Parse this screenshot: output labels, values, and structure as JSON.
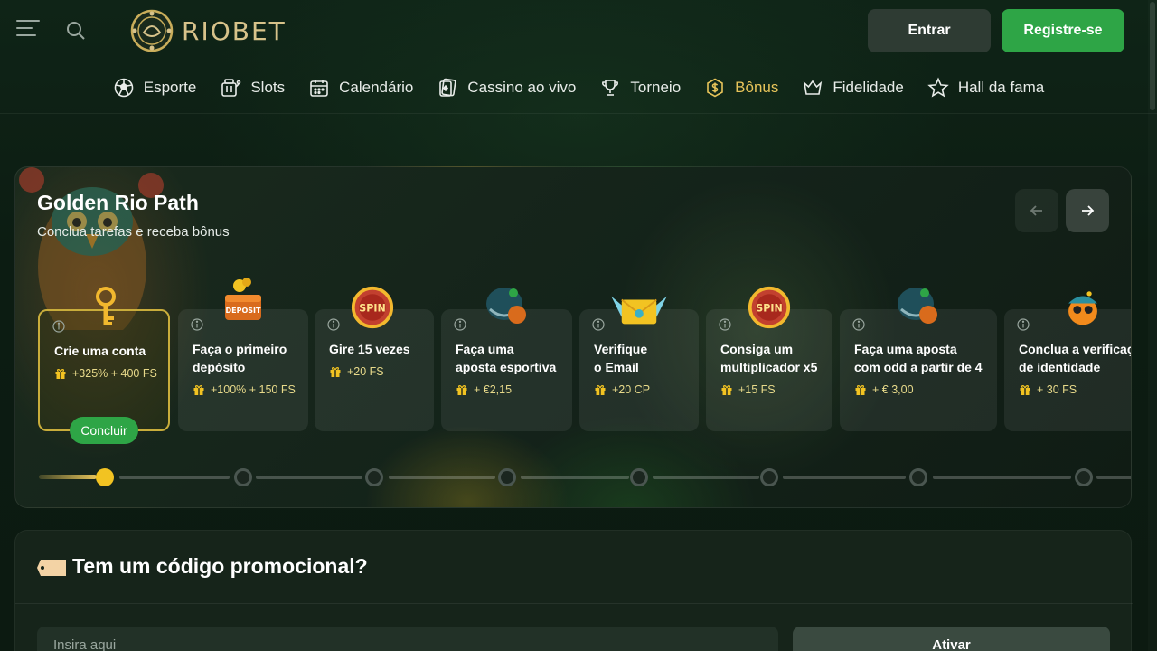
{
  "header": {
    "brand": "RIOBET",
    "login_label": "Entrar",
    "register_label": "Registre-se"
  },
  "nav": {
    "items": [
      {
        "label": "Esporte",
        "icon": "soccer-ball-icon"
      },
      {
        "label": "Slots",
        "icon": "slot-machine-icon"
      },
      {
        "label": "Calendário",
        "icon": "calendar-icon"
      },
      {
        "label": "Cassino ao vivo",
        "icon": "cards-icon"
      },
      {
        "label": "Torneio",
        "icon": "trophy-icon"
      },
      {
        "label": "Bônus",
        "icon": "dollar-coin-icon",
        "active": true
      },
      {
        "label": "Fidelidade",
        "icon": "crown-icon"
      },
      {
        "label": "Hall da fama",
        "icon": "star-icon"
      }
    ]
  },
  "path": {
    "title": "Golden Rio Path",
    "subtitle": "Conclua tarefas e receba bônus",
    "tasks": [
      {
        "title": "Crie uma conta",
        "reward": "+325% + 400 FS",
        "icon": "key-icon",
        "active": true,
        "action": "Concluir"
      },
      {
        "title": "Faça o primeiro\ndepósito",
        "reward": "+100% + 150 FS",
        "icon": "deposit-chest-icon",
        "icon_text": "DEPOSIT"
      },
      {
        "title": "Gire 15 vezes",
        "reward": "+20 FS",
        "icon": "spin-badge-icon",
        "icon_text": "SPIN"
      },
      {
        "title": "Faça uma\naposta esportiva",
        "reward": "+ €2,15",
        "icon": "helmet-ball-icon"
      },
      {
        "title": "Verifique\no Email",
        "reward": "+20 CP",
        "icon": "winged-envelope-icon"
      },
      {
        "title": "Consiga um\nmultiplicador x5",
        "reward": "+15 FS",
        "icon": "spin-badge-icon",
        "icon_text": "SPIN"
      },
      {
        "title": "Faça uma aposta\ncom odd a partir de 4",
        "reward": "+ € 3,00",
        "icon": "helmet-ball-icon"
      },
      {
        "title": "Conclua a verificação\nde identidade",
        "reward": "+ 30 FS",
        "icon": "orange-bird-icon"
      }
    ],
    "progress": {
      "completed_steps": 1,
      "total_steps": 8
    }
  },
  "promo": {
    "title": "Tem um código promocional?",
    "placeholder": "Insira aqui",
    "activate_label": "Ativar"
  },
  "colors": {
    "accent_green": "#2ea546",
    "accent_gold": "#e7c45a",
    "background": "#0d1a12"
  }
}
